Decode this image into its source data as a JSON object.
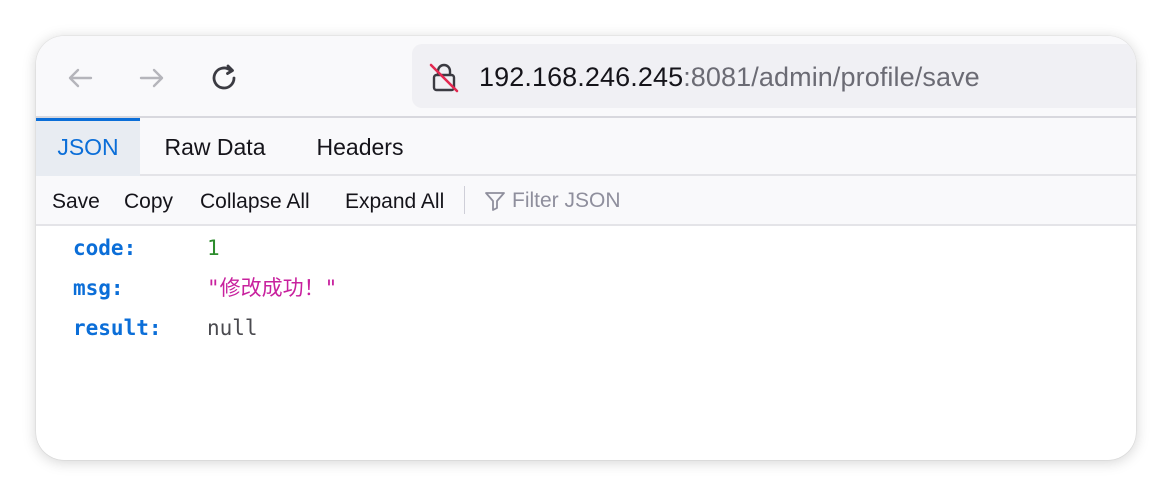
{
  "browser": {
    "url_host": "192.168.246.245",
    "url_path": ":8081/admin/profile/save",
    "icons": [
      "back-arrow-icon",
      "forward-arrow-icon",
      "reload-icon",
      "insecure-lock-icon"
    ]
  },
  "tabs": [
    {
      "label": "JSON",
      "active": true
    },
    {
      "label": "Raw Data",
      "active": false
    },
    {
      "label": "Headers",
      "active": false
    }
  ],
  "actions": {
    "save": "Save",
    "copy": "Copy",
    "collapse_all": "Collapse All",
    "expand_all": "Expand All",
    "filter_placeholder": "Filter JSON"
  },
  "json": [
    {
      "key": "code:",
      "value": "1",
      "type": "number"
    },
    {
      "key": "msg:",
      "value": "\"修改成功！\"",
      "type": "string"
    },
    {
      "key": "result:",
      "value": "null",
      "type": "null"
    }
  ],
  "colors": {
    "accent": "#0b6ed8",
    "number": "#2c8c2c",
    "string": "#c8219e",
    "null": "#4a4a4f"
  }
}
